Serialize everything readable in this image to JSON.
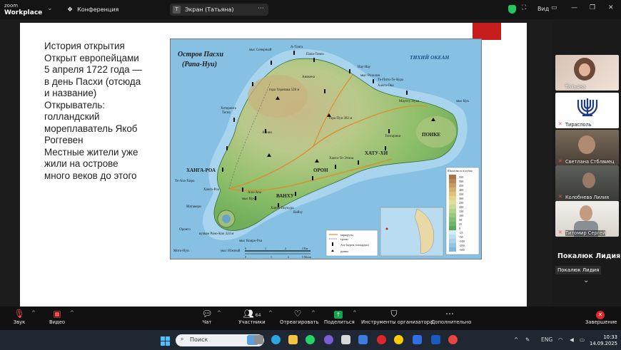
{
  "titlebar": {
    "logo_line1": "zoom",
    "logo_line2": "Workplace",
    "tab1_label": "Конференция",
    "tab2_label": "Экран (Татьяна)",
    "view_label": "Вид"
  },
  "slide": {
    "text": "История открытия\nОткрыт европейцами\n5 апреля 1722 года —\nв день Пасхи (отсюда\nи название)\nОткрыватель:\nголландский\nмореплаватель Якоб\nРоггевен\nМестные жители уже\nжили на острове\nмного веков до этого"
  },
  "map": {
    "title_line1": "Остров Пасхи",
    "title_line2": "(Рапа-Нуи)",
    "ocean_label": "ТИХИЙ ОКЕАН",
    "regions": [
      "ХАНГА-РОА",
      "ХАТУ-ХИ",
      "ОРОН",
      "ВАНХУ",
      "ПОИКЕ"
    ],
    "places": [
      "А-Тонга",
      "Папа-Тенеа",
      "мыс Северный",
      "Анакена",
      "Нау-Нау",
      "мыс Розалия",
      "Те-Пито-Те-Кура",
      "Ханга-Ова",
      "мыс Кук",
      "Тонгарики",
      "Маунгу Пука",
      "Ханга-Те-Этиоа",
      "Хетеренга",
      "Акиви",
      "Тепеу",
      "мыс Куки",
      "Матавери",
      "Оронго",
      "Мото-Нуи",
      "мыс Южный",
      "мыс Коиро-Роа",
      "Ханга-Поукура",
      "Вайху",
      "Ахи-Ана",
      "гора Теревака 528 м",
      "гора Пуи 302 м",
      "вулкан Рано-Као 324 м",
      "Ханга-Роа",
      "Те-Ата-Хиро"
    ],
    "legend_title": "Шкала высот и глубин",
    "legend_values": [
      "550",
      "500",
      "450",
      "400",
      "350",
      "300",
      "250",
      "200",
      "150",
      "100",
      "50",
      "25",
      "0",
      "-25",
      "-50",
      "-100",
      "-200",
      "-300"
    ],
    "key_items": [
      "маршруты",
      "тропы",
      "Аху (церем. площадки)",
      "руины"
    ],
    "scale_labels": [
      "0",
      "1",
      "2",
      "3 Км",
      "0",
      "1",
      "2",
      "3 Мили"
    ]
  },
  "panel": {
    "tiles": [
      {
        "name": "Татьяна",
        "muted": false
      },
      {
        "name": "Тирасполь",
        "muted": true
      },
      {
        "name": "Светлана Стблвиец",
        "muted": true
      },
      {
        "name": "Колобнева Лилия",
        "muted": true
      },
      {
        "name": "Титомир Сергей",
        "muted": true
      }
    ],
    "active_speaker": "Покалюк Лидия",
    "active_speaker_label": "Покалюк Лидия"
  },
  "toolbar": {
    "audio": "Звук",
    "video": "Видео",
    "chat": "Чат",
    "participants": "Участники",
    "participants_count": "64",
    "react": "Отреагировать",
    "share": "Поделиться",
    "host_tools": "Инструменты организатора",
    "more": "Дополнительно",
    "leave": "Завершение"
  },
  "taskbar": {
    "search_placeholder": "Поиск",
    "lang": "ENG",
    "time": "10:33",
    "date": "14.09.2025"
  },
  "colors": {
    "accent_red": "#c81d1d",
    "security_green": "#22c55e",
    "share_green": "#16a34a",
    "leave_red": "#e02828"
  }
}
